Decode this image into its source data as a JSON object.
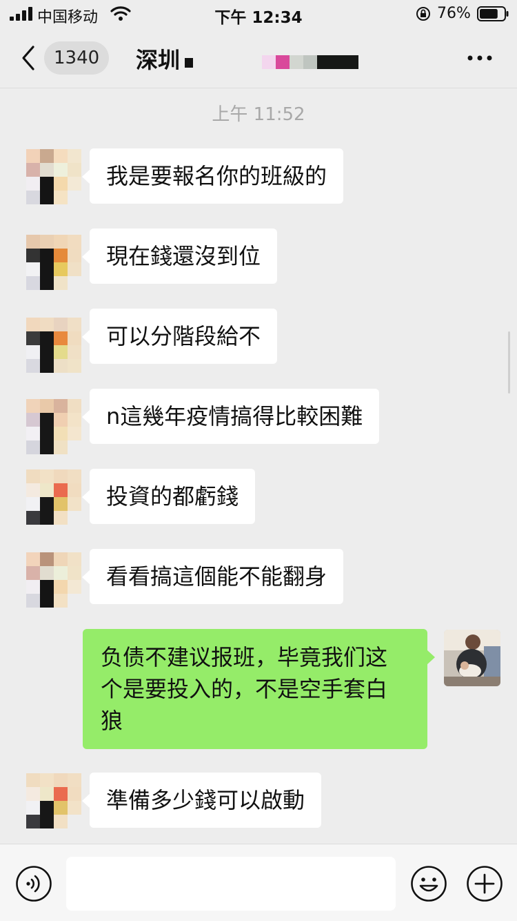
{
  "status_bar": {
    "carrier": "中国移动",
    "time": "下午 12:34",
    "battery_percent": "76%",
    "battery_level": 0.76
  },
  "nav": {
    "back_icon": "chevron-left-icon",
    "unread_count": "1340",
    "title": "深圳",
    "more_icon": "more-dots-icon"
  },
  "time_divider": "上午 11:52",
  "messages": [
    {
      "side": "received",
      "text": "我是要報名你的班級的"
    },
    {
      "side": "received",
      "text": "現在錢還沒到位"
    },
    {
      "side": "received",
      "text": "可以分階段給不"
    },
    {
      "side": "received",
      "text": "n這幾年疫情搞得比較困難"
    },
    {
      "side": "received",
      "text": "投資的都虧錢"
    },
    {
      "side": "received",
      "text": "看看搞這個能不能翻身"
    },
    {
      "side": "sent",
      "lines": [
        "负债不建议报班，毕竟我们这",
        "个是要投入的，不是空手套白",
        "狼"
      ]
    },
    {
      "side": "received",
      "text": "準備多少錢可以啟動"
    }
  ],
  "input_bar": {
    "voice_icon": "voice-icon",
    "placeholder": "",
    "emoji_icon": "emoji-icon",
    "plus_icon": "plus-icon"
  },
  "colors": {
    "background": "#ededed",
    "received_bubble": "#ffffff",
    "sent_bubble": "#95ec69"
  }
}
